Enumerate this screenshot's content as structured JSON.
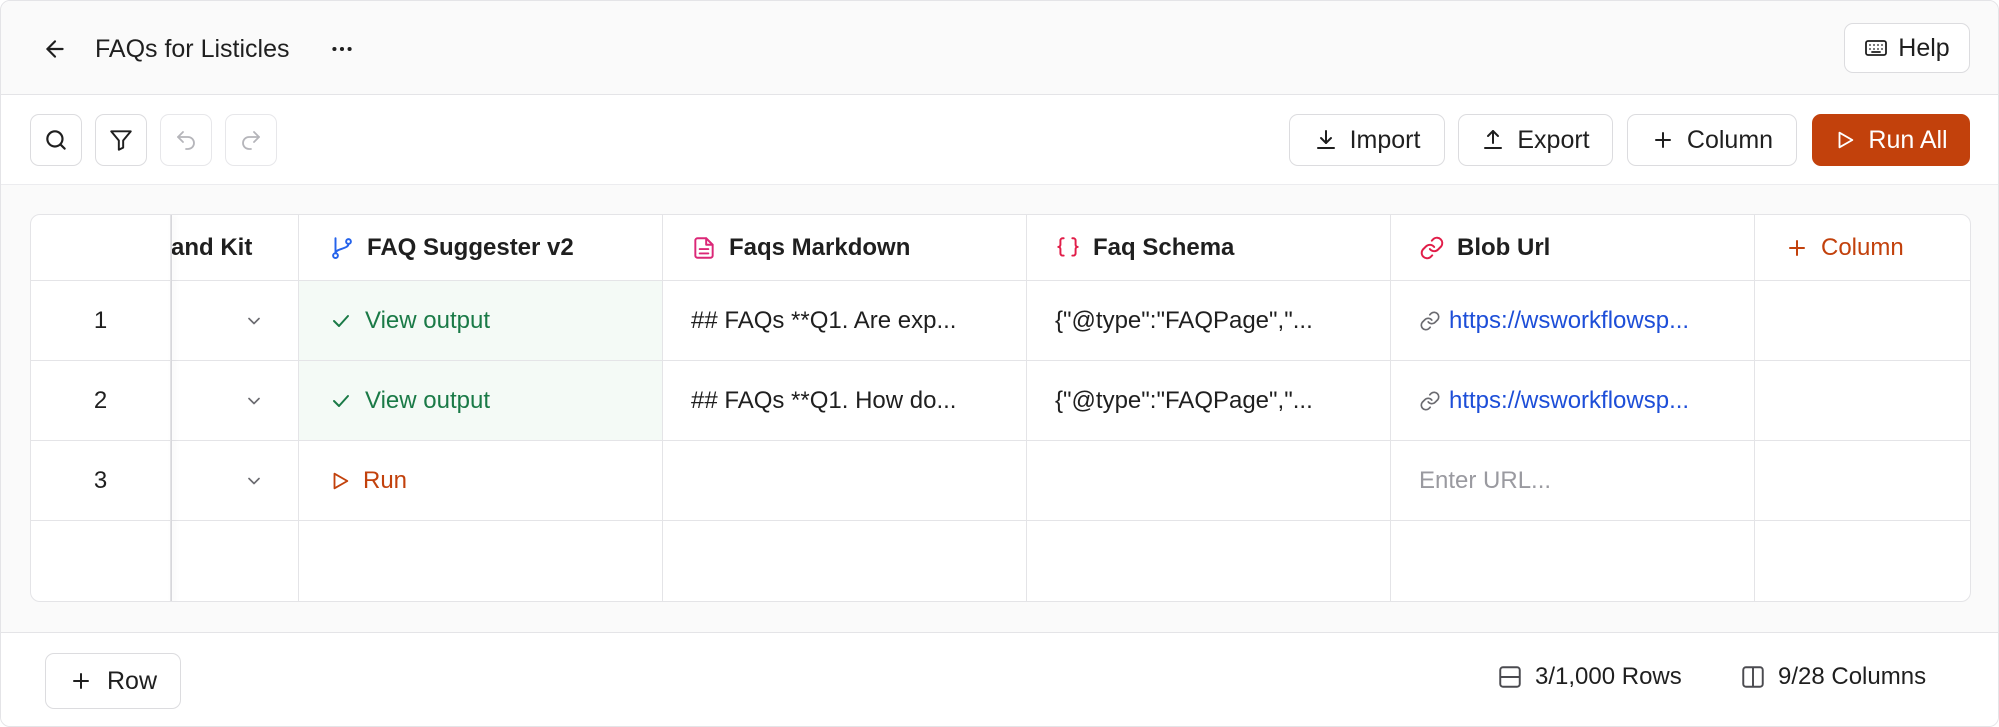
{
  "header": {
    "title": "FAQs for Listicles",
    "help_label": "Help"
  },
  "toolbar": {
    "import_label": "Import",
    "export_label": "Export",
    "column_label": "Column",
    "run_all_label": "Run All"
  },
  "table": {
    "columns": [
      {
        "label": "and Kit",
        "icon": "none"
      },
      {
        "label": "FAQ Suggester v2",
        "icon": "branch-icon"
      },
      {
        "label": "Faqs Markdown",
        "icon": "document-icon"
      },
      {
        "label": "Faq Schema",
        "icon": "braces-icon"
      },
      {
        "label": "Blob Url",
        "icon": "link-icon"
      },
      {
        "label": "Column",
        "icon": "plus-icon"
      }
    ],
    "rows": [
      {
        "num": "1",
        "agent": "View output",
        "agent_status": "done",
        "markdown": "## FAQs  **Q1. Are exp...",
        "schema": "{\"@type\":\"FAQPage\",\"...",
        "url": "https://wsworkflowsp..."
      },
      {
        "num": "2",
        "agent": "View output",
        "agent_status": "done",
        "markdown": "## FAQs  **Q1. How do...",
        "schema": "{\"@type\":\"FAQPage\",\"...",
        "url": "https://wsworkflowsp..."
      },
      {
        "num": "3",
        "agent": "Run",
        "agent_status": "pending",
        "markdown": "",
        "schema": "",
        "url_placeholder": "Enter URL..."
      }
    ]
  },
  "footer": {
    "row_label": "Row",
    "rows_stat": "3/1,000 Rows",
    "columns_stat": "9/28 Columns"
  },
  "colors": {
    "accent": "#c2410c",
    "success": "#1a7a47",
    "link": "#1d4ed8",
    "branch_icon": "#2563eb",
    "document_icon": "#db2777",
    "braces_icon": "#e11d48"
  }
}
